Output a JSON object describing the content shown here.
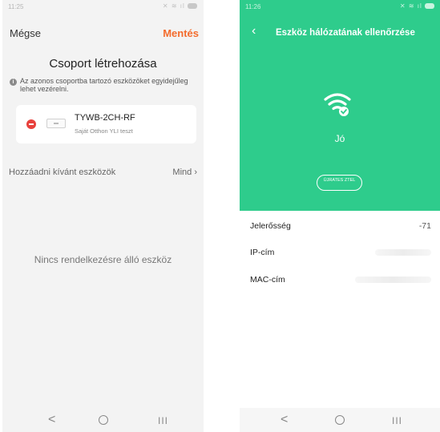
{
  "left": {
    "status": {
      "time": "11:25"
    },
    "header": {
      "cancel_label": "Mégse",
      "save_label": "Mentés"
    },
    "title": "Csoport létrehozása",
    "info_text": "Az azonos csoportba tartozó eszközöket egyidejűleg lehet vezérelni.",
    "device": {
      "name": "TYWB-2CH-RF",
      "subtitle": "Saját Otthon YLI teszt"
    },
    "add_section": {
      "label": "Hozzáadni kívánt eszközök",
      "all_label": "Mind"
    },
    "empty_text": "Nincs rendelkezésre álló eszköz"
  },
  "right": {
    "status": {
      "time": "11:26"
    },
    "title": "Eszköz hálózatának ellenőrzése",
    "signal_quality": "Jó",
    "retest_label": "ÚJRATES ZTEL",
    "rows": [
      {
        "label": "Jelerősség",
        "value": "-71"
      },
      {
        "label": "IP-cím",
        "value": ""
      },
      {
        "label": "MAC-cím",
        "value": ""
      }
    ]
  },
  "nav": {
    "back": "<",
    "recents": "III"
  },
  "colors": {
    "accent_orange": "#f36b2c",
    "green": "#2ecc8c",
    "remove_red": "#e8413c"
  }
}
